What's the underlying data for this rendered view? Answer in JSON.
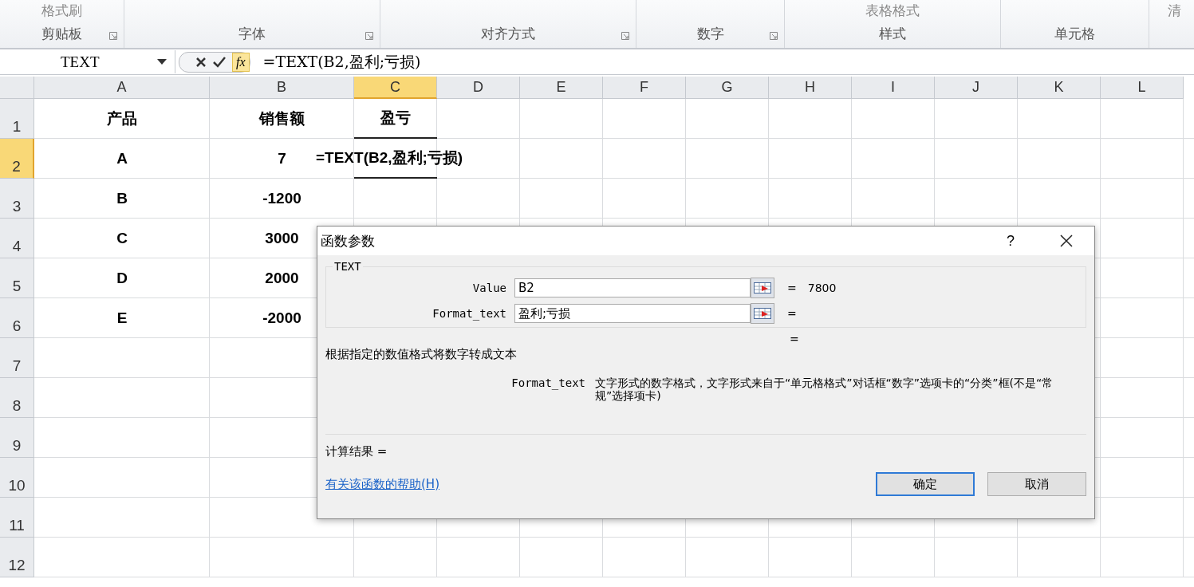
{
  "ribbon": {
    "groups": [
      {
        "label": "剪贴板",
        "items": [
          "格式刷"
        ],
        "launcher": true
      },
      {
        "label": "字体",
        "launcher": true
      },
      {
        "label": "对齐方式",
        "launcher": true
      },
      {
        "label": "数字",
        "launcher": true
      },
      {
        "label": "样式",
        "items": [
          "表格格式"
        ]
      },
      {
        "label": "单元格"
      },
      {
        "items": [
          "清"
        ]
      }
    ]
  },
  "formula_bar": {
    "name_box": "TEXT",
    "fx": "fx",
    "formula": "=TEXT(B2,盈利;亏损)"
  },
  "sheet": {
    "columns": [
      {
        "label": "A",
        "selected": false
      },
      {
        "label": "B",
        "selected": false
      },
      {
        "label": "C",
        "selected": true
      },
      {
        "label": "D",
        "selected": false
      },
      {
        "label": "E",
        "selected": false
      },
      {
        "label": "F",
        "selected": false
      },
      {
        "label": "G",
        "selected": false
      },
      {
        "label": "H",
        "selected": false
      },
      {
        "label": "I",
        "selected": false
      },
      {
        "label": "J",
        "selected": false
      },
      {
        "label": "K",
        "selected": false
      },
      {
        "label": "L",
        "selected": false
      }
    ],
    "rows": [
      {
        "label": "1",
        "selected": false,
        "cells": [
          "产品",
          "销售额",
          "盈亏"
        ]
      },
      {
        "label": "2",
        "selected": true,
        "cells": [
          "A",
          "7",
          "=TEXT(B2,盈利;亏损)"
        ]
      },
      {
        "label": "3",
        "selected": false,
        "cells": [
          "B",
          "-1200",
          ""
        ]
      },
      {
        "label": "4",
        "selected": false,
        "cells": [
          "C",
          "3000",
          ""
        ]
      },
      {
        "label": "5",
        "selected": false,
        "cells": [
          "D",
          "2000",
          ""
        ]
      },
      {
        "label": "6",
        "selected": false,
        "cells": [
          "E",
          "-2000",
          ""
        ]
      },
      {
        "label": "7",
        "selected": false,
        "cells": []
      },
      {
        "label": "8",
        "selected": false,
        "cells": []
      },
      {
        "label": "9",
        "selected": false,
        "cells": []
      },
      {
        "label": "10",
        "selected": false,
        "cells": []
      },
      {
        "label": "11",
        "selected": false,
        "cells": []
      },
      {
        "label": "12",
        "selected": false,
        "cells": []
      }
    ]
  },
  "dialog": {
    "title": "函数参数",
    "help": "?",
    "function_name": "TEXT",
    "arguments": [
      {
        "label": "Value",
        "value": "B2",
        "result": "7800"
      },
      {
        "label": "Format_text",
        "value": "盈利;亏损"
      }
    ],
    "result_sign": "=",
    "description": "根据指定的数值格式将数字转成文本",
    "argument_help": {
      "name": "Format_text",
      "text": "文字形式的数字格式，文字形式来自于“单元格格式”对话框“数字”选项卡的“分类”框(不是“常规”选择项卡)"
    },
    "calc_result": "计算结果 =",
    "help_link": "有关该函数的帮助(H)",
    "buttons": [
      {
        "label": "确定",
        "default": true
      },
      {
        "label": "取消",
        "default": false
      }
    ]
  }
}
